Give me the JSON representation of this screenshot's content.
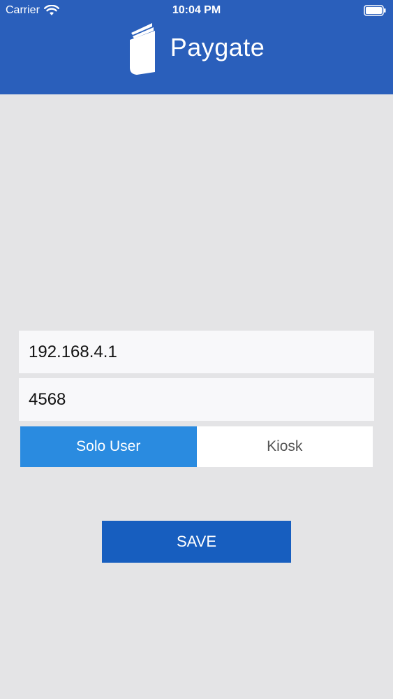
{
  "status_bar": {
    "carrier": "Carrier",
    "time": "10:04 PM",
    "wifi_icon": "wifi-icon",
    "battery_icon": "battery-icon"
  },
  "header": {
    "title": "Paygate",
    "logo_icon": "wallet-logo-icon",
    "background": "#2a5fbb"
  },
  "form": {
    "ip_value": "192.168.4.1",
    "port_value": "4568"
  },
  "mode": {
    "options": [
      "Solo User",
      "Kiosk"
    ],
    "selected": "Solo User",
    "active_color": "#2a8be0"
  },
  "actions": {
    "save_label": "SAVE",
    "save_color": "#175ebf"
  }
}
